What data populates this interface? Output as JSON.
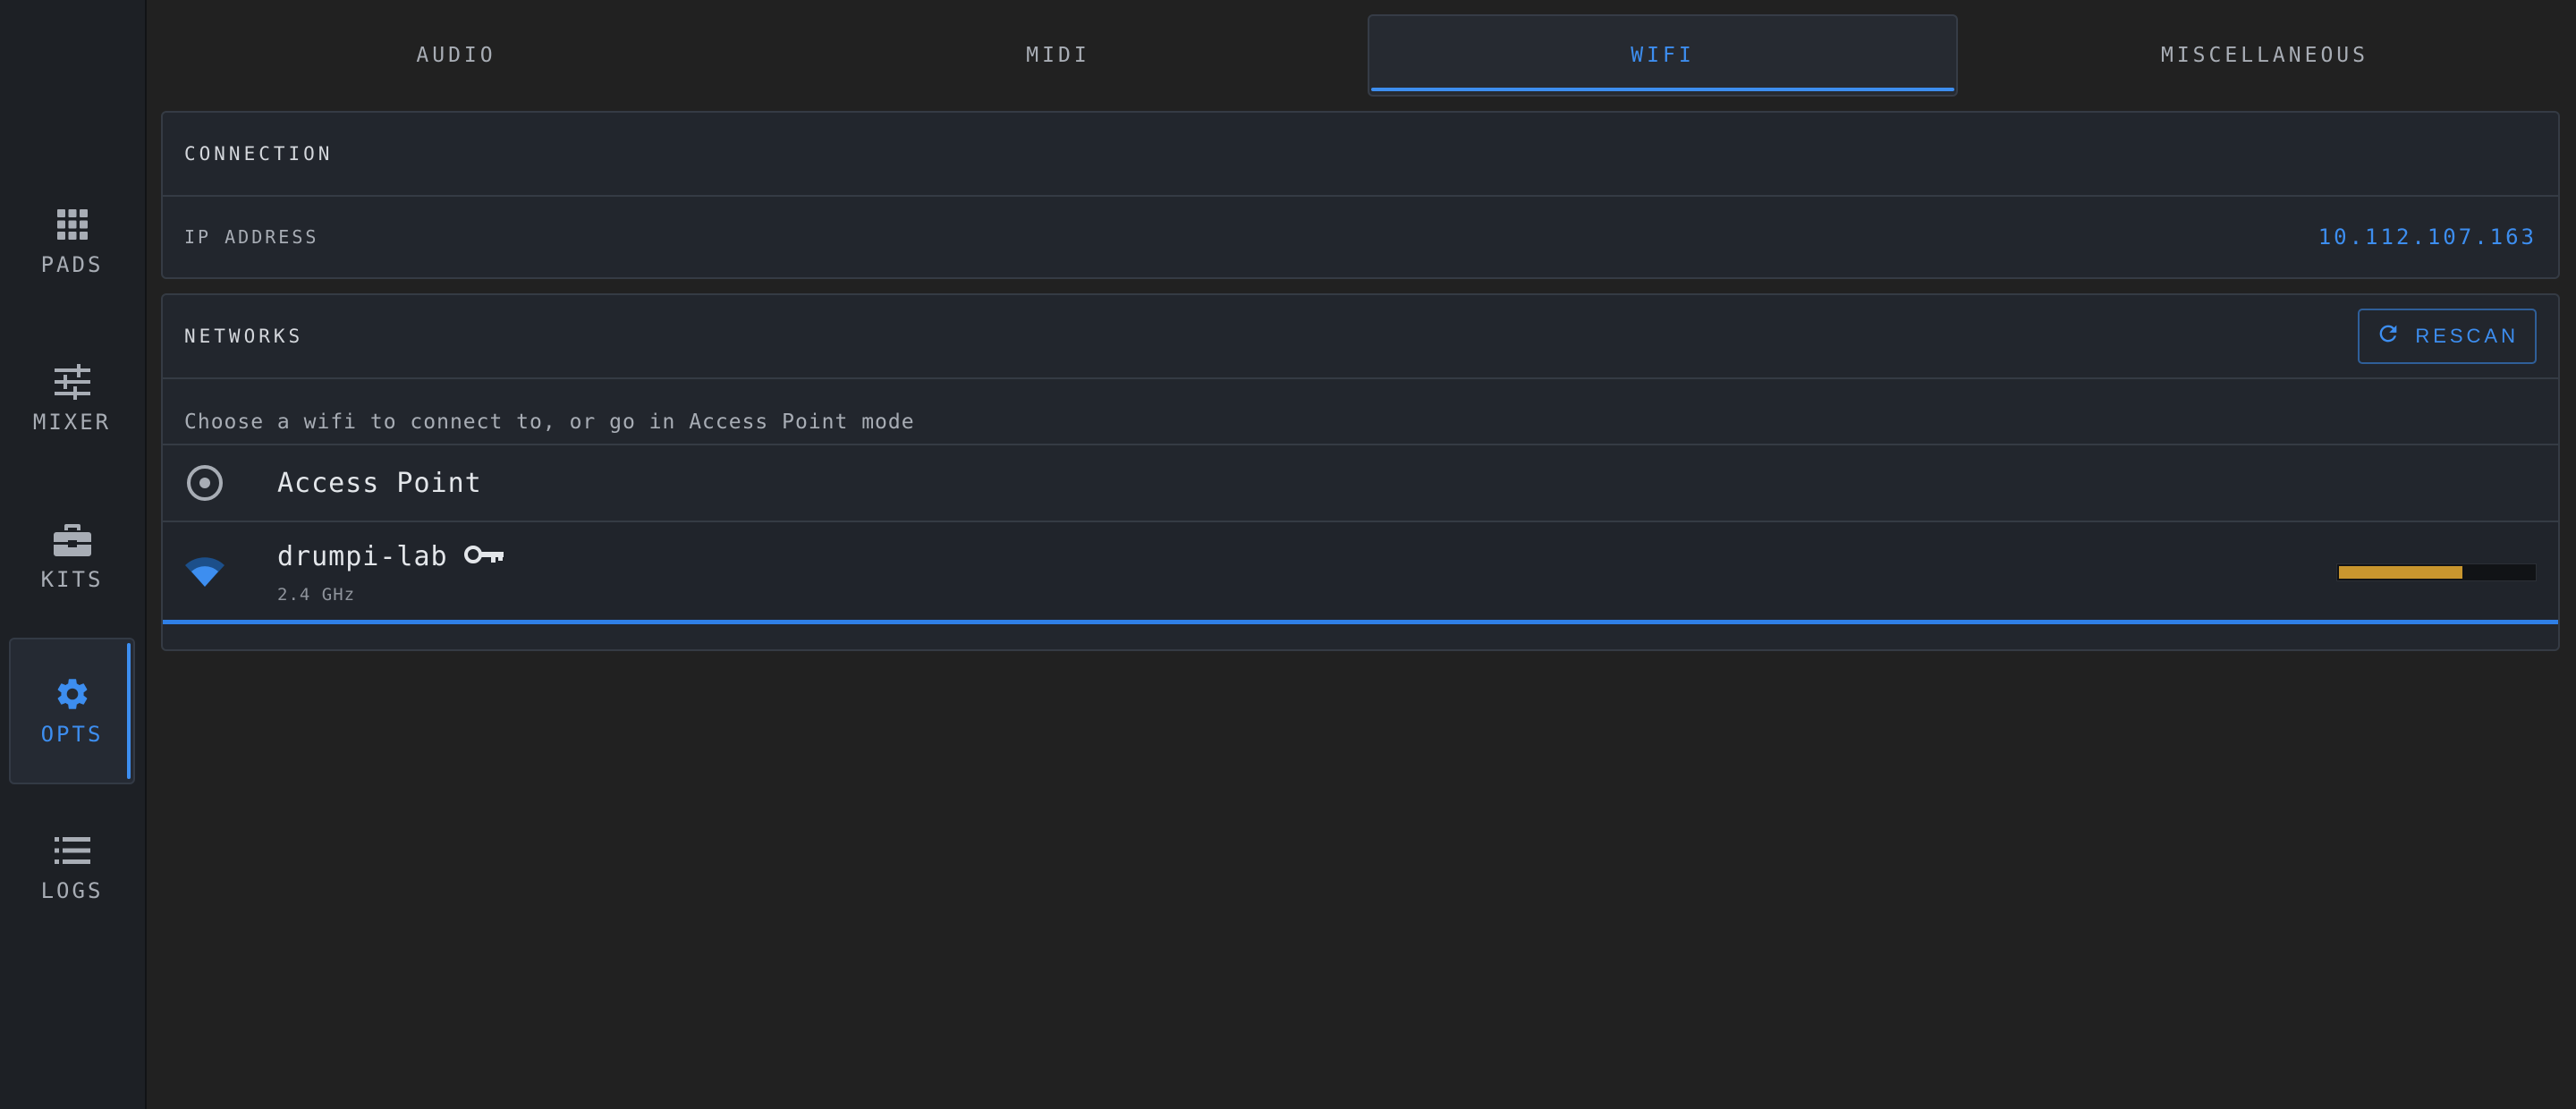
{
  "sidebar": {
    "items": [
      {
        "label": "PADS",
        "icon": "grid-icon",
        "active": false
      },
      {
        "label": "MIXER",
        "icon": "sliders-icon",
        "active": false
      },
      {
        "label": "KITS",
        "icon": "briefcase-icon",
        "active": false
      },
      {
        "label": "OPTS",
        "icon": "gear-icon",
        "active": true
      },
      {
        "label": "LOGS",
        "icon": "list-icon",
        "active": false
      }
    ]
  },
  "tabs": [
    {
      "label": "AUDIO",
      "active": false
    },
    {
      "label": "MIDI",
      "active": false
    },
    {
      "label": "WIFI",
      "active": true
    },
    {
      "label": "MISCELLANEOUS",
      "active": false
    }
  ],
  "connection": {
    "title": "CONNECTION",
    "ip_label": "IP ADDRESS",
    "ip_value": "10.112.107.163"
  },
  "networks": {
    "title": "NETWORKS",
    "rescan_label": "RESCAN",
    "hint": "Choose a wifi to connect to, or go in Access Point mode",
    "access_point": {
      "name": "Access Point",
      "icon": "radio-target-icon"
    },
    "list": [
      {
        "ssid": "drumpi-lab",
        "band": "2.4 GHz",
        "secured": true,
        "signal_fraction": 0.63,
        "selected": true
      }
    ]
  },
  "colors": {
    "accent": "#3d8ef0",
    "signal": "#c9962e",
    "background": "#212121"
  }
}
